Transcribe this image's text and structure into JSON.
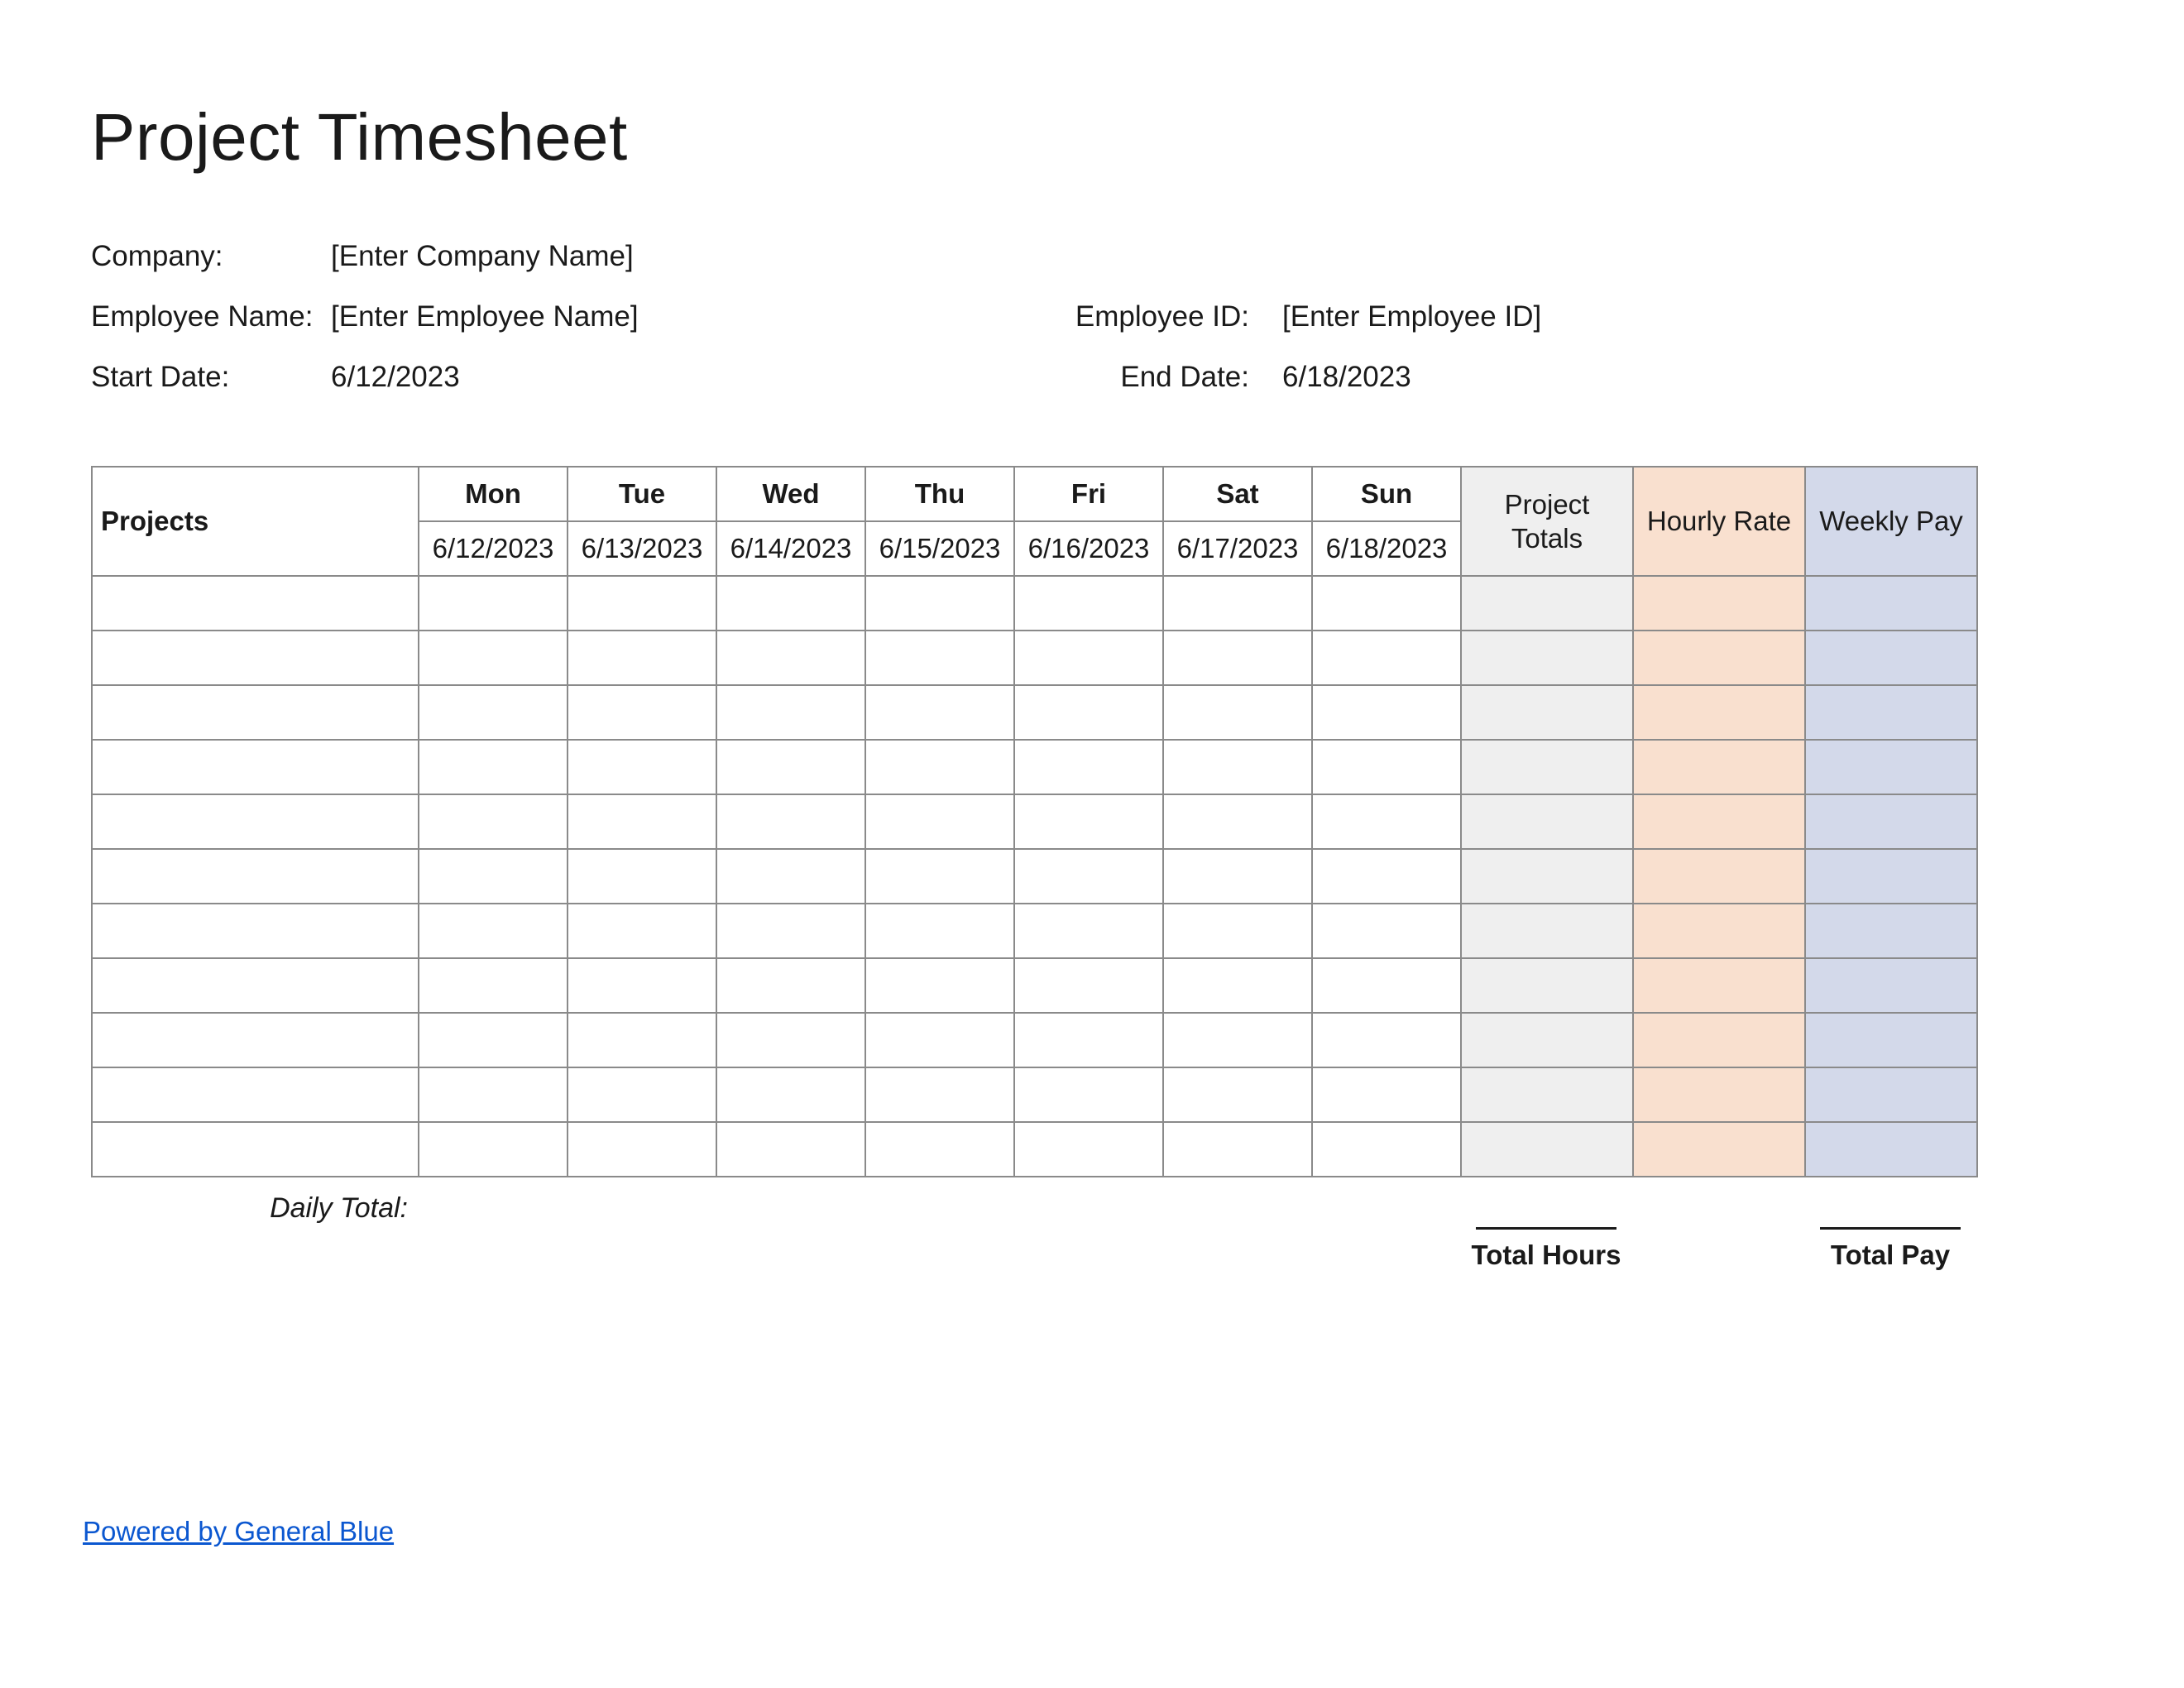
{
  "title": "Project Timesheet",
  "meta": {
    "company_label": "Company:",
    "company_value": "[Enter Company Name]",
    "employee_name_label": "Employee Name:",
    "employee_name_value": "[Enter Employee Name]",
    "employee_id_label": "Employee ID:",
    "employee_id_value": "[Enter Employee ID]",
    "start_date_label": "Start Date:",
    "start_date_value": "6/12/2023",
    "end_date_label": "End Date:",
    "end_date_value": "6/18/2023"
  },
  "table": {
    "projects_header": "Projects",
    "days": [
      {
        "name": "Mon",
        "date": "6/12/2023"
      },
      {
        "name": "Tue",
        "date": "6/13/2023"
      },
      {
        "name": "Wed",
        "date": "6/14/2023"
      },
      {
        "name": "Thu",
        "date": "6/15/2023"
      },
      {
        "name": "Fri",
        "date": "6/16/2023"
      },
      {
        "name": "Sat",
        "date": "6/17/2023"
      },
      {
        "name": "Sun",
        "date": "6/18/2023"
      }
    ],
    "summary_headers": {
      "project_totals": "Project Totals",
      "hourly_rate": "Hourly Rate",
      "weekly_pay": "Weekly Pay"
    },
    "rows": [
      {
        "project": "",
        "hours": [
          "",
          "",
          "",
          "",
          "",
          "",
          ""
        ],
        "project_total": "",
        "hourly_rate": "",
        "weekly_pay": ""
      },
      {
        "project": "",
        "hours": [
          "",
          "",
          "",
          "",
          "",
          "",
          ""
        ],
        "project_total": "",
        "hourly_rate": "",
        "weekly_pay": ""
      },
      {
        "project": "",
        "hours": [
          "",
          "",
          "",
          "",
          "",
          "",
          ""
        ],
        "project_total": "",
        "hourly_rate": "",
        "weekly_pay": ""
      },
      {
        "project": "",
        "hours": [
          "",
          "",
          "",
          "",
          "",
          "",
          ""
        ],
        "project_total": "",
        "hourly_rate": "",
        "weekly_pay": ""
      },
      {
        "project": "",
        "hours": [
          "",
          "",
          "",
          "",
          "",
          "",
          ""
        ],
        "project_total": "",
        "hourly_rate": "",
        "weekly_pay": ""
      },
      {
        "project": "",
        "hours": [
          "",
          "",
          "",
          "",
          "",
          "",
          ""
        ],
        "project_total": "",
        "hourly_rate": "",
        "weekly_pay": ""
      },
      {
        "project": "",
        "hours": [
          "",
          "",
          "",
          "",
          "",
          "",
          ""
        ],
        "project_total": "",
        "hourly_rate": "",
        "weekly_pay": ""
      },
      {
        "project": "",
        "hours": [
          "",
          "",
          "",
          "",
          "",
          "",
          ""
        ],
        "project_total": "",
        "hourly_rate": "",
        "weekly_pay": ""
      },
      {
        "project": "",
        "hours": [
          "",
          "",
          "",
          "",
          "",
          "",
          ""
        ],
        "project_total": "",
        "hourly_rate": "",
        "weekly_pay": ""
      },
      {
        "project": "",
        "hours": [
          "",
          "",
          "",
          "",
          "",
          "",
          ""
        ],
        "project_total": "",
        "hourly_rate": "",
        "weekly_pay": ""
      },
      {
        "project": "",
        "hours": [
          "",
          "",
          "",
          "",
          "",
          "",
          ""
        ],
        "project_total": "",
        "hourly_rate": "",
        "weekly_pay": ""
      }
    ],
    "daily_total_label": "Daily Total:",
    "total_hours_label": "Total Hours",
    "total_pay_label": "Total Pay"
  },
  "footer": {
    "powered_by": "Powered by General Blue"
  }
}
